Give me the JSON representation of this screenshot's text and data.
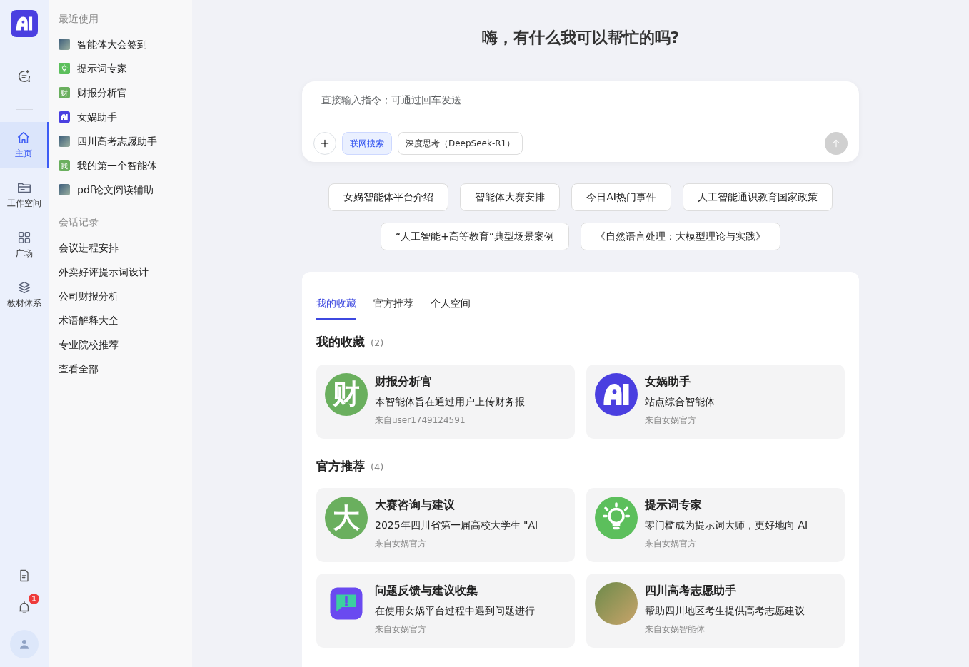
{
  "rail": {
    "items": [
      {
        "kind": "home",
        "label": "主页",
        "selected": true
      },
      {
        "kind": "folder",
        "label": "工作空间",
        "selected": false
      },
      {
        "kind": "grid",
        "label": "广场",
        "selected": false
      },
      {
        "kind": "layers",
        "label": "教材体系",
        "selected": false
      }
    ],
    "notification_count": "1"
  },
  "recent": {
    "title": "最近使用",
    "items": [
      {
        "kind": "photo",
        "label": "智能体大会签到"
      },
      {
        "kind": "bulb",
        "label": "提示词专家",
        "color": "#5cbf5c"
      },
      {
        "kind": "text",
        "glyph": "财",
        "label": "财报分析官",
        "color": "#6aaf5e"
      },
      {
        "kind": "logo",
        "label": "女娲助手",
        "color": "#4a3fe0"
      },
      {
        "kind": "photo",
        "label": "四川高考志愿助手"
      },
      {
        "kind": "text",
        "glyph": "我",
        "label": "我的第一个智能体",
        "color": "#6aaf5e"
      },
      {
        "kind": "photo",
        "label": "pdf论文阅读辅助"
      }
    ]
  },
  "history": {
    "title": "会话记录",
    "items": [
      "会议进程安排",
      "外卖好评提示词设计",
      "公司财报分析",
      "术语解释大全",
      "专业院校推荐"
    ],
    "view_all": "查看全部"
  },
  "greeting": "嗨，有什么我可以帮忙的吗?",
  "composer": {
    "placeholder": "直接输入指令；可通过回车发送",
    "toggles": [
      {
        "label": "联网搜索",
        "selected": true
      },
      {
        "label": "深度思考（DeepSeek-R1）",
        "selected": false
      }
    ]
  },
  "suggestions": [
    [
      "女娲智能体平台介绍",
      "智能体大赛安排",
      "今日AI热门事件",
      "人工智能通识教育国家政策"
    ],
    [
      "“人工智能+高等教育”典型场景案例",
      "《自然语言处理：大模型理论与实践》"
    ]
  ],
  "tabs": [
    {
      "label": "我的收藏",
      "selected": true
    },
    {
      "label": "官方推荐",
      "selected": false
    },
    {
      "label": "个人空间",
      "selected": false
    }
  ],
  "sections": [
    {
      "title": "我的收藏",
      "count": "(2)",
      "cards": [
        {
          "kind": "text",
          "glyph": "财",
          "color": "#6aaf5e",
          "title": "财报分析官",
          "description": "本智能体旨在通过用户上传财务报",
          "source": "来自user1749124591"
        },
        {
          "kind": "logo",
          "color": "#4a3fe0",
          "title": "女娲助手",
          "description": "站点综合智能体",
          "source": "来自女娲官方"
        }
      ]
    },
    {
      "title": "官方推荐",
      "count": "(4)",
      "cards": [
        {
          "kind": "text",
          "glyph": "大",
          "color": "#6aaf5e",
          "title": "大赛咨询与建议",
          "description": "2025年四川省第一届高校大学生 \"AI",
          "source": "来自女娲官方"
        },
        {
          "kind": "bulb",
          "color": "#5cbf5c",
          "title": "提示词专家",
          "description": "零门槛成为提示词大师，更好地向 AI",
          "source": "来自女娲官方"
        },
        {
          "kind": "feedback",
          "color": "#6a4af0",
          "title": "问题反馈与建议收集",
          "description": "在使用女娲平台过程中遇到问题进行",
          "source": "来自女娲官方"
        },
        {
          "kind": "photo",
          "title": "四川高考志愿助手",
          "description": "帮助四川地区考生提供高考志愿建议",
          "source": "来自女娲智能体"
        }
      ]
    }
  ]
}
